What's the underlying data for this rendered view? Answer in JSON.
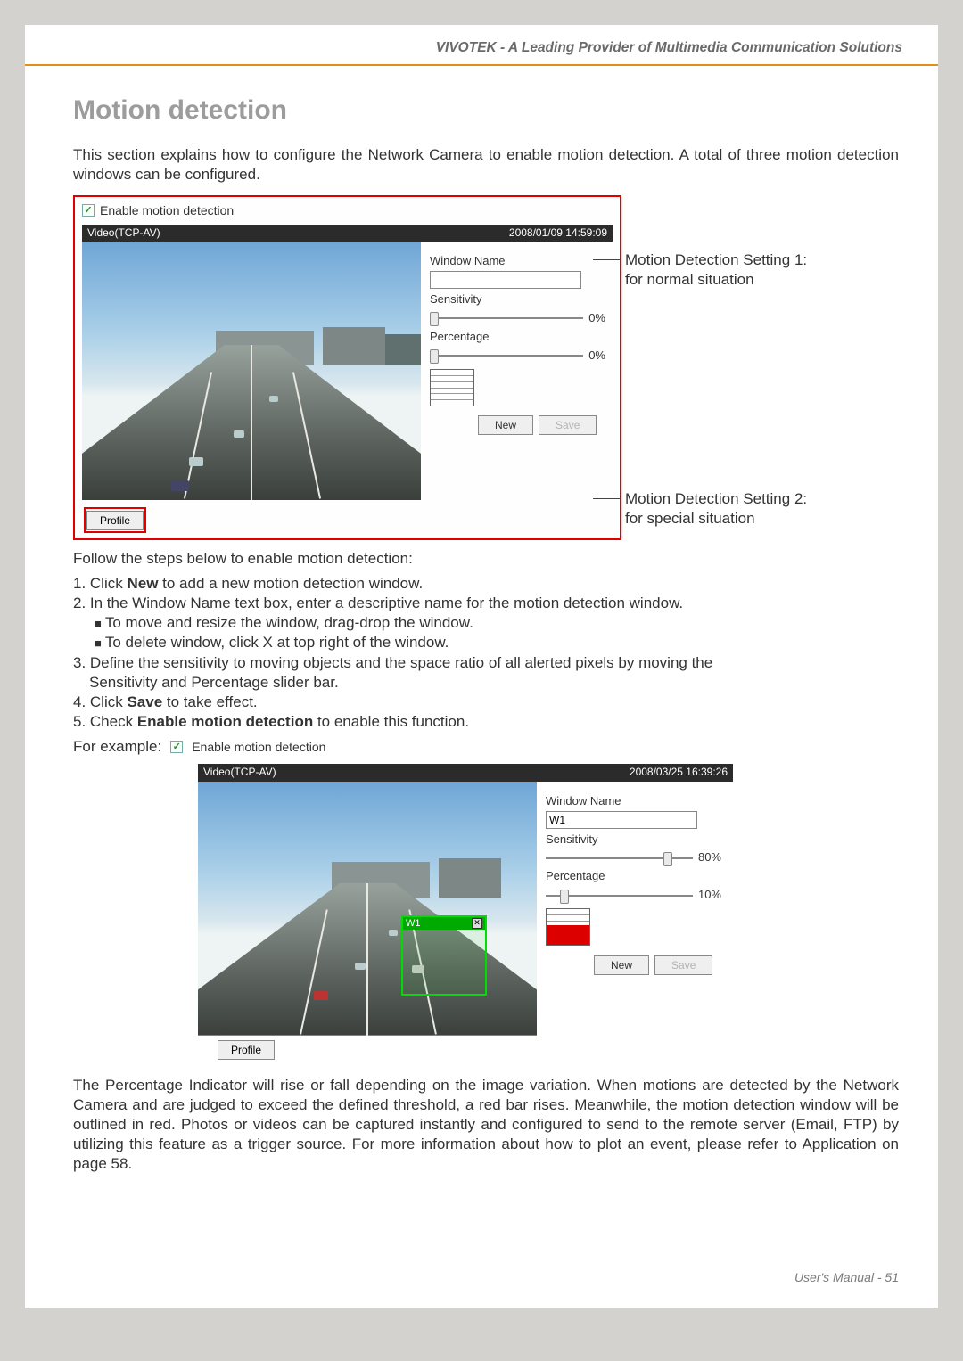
{
  "header": "VIVOTEK - A Leading Provider of Multimedia Communication Solutions",
  "title": "Motion detection",
  "intro": "This section explains how to configure the Network Camera to enable motion detection. A total of three motion detection windows can be configured.",
  "panel1": {
    "enable_label": "Enable motion detection",
    "video_label": "Video(TCP-AV)",
    "timestamp": "2008/01/09 14:59:09",
    "wnd_label": "Window Name",
    "wnd_value": "",
    "sens_label": "Sensitivity",
    "sens_value": "0%",
    "pct_label": "Percentage",
    "pct_value": "0%",
    "new_btn": "New",
    "save_btn": "Save",
    "profile_btn": "Profile"
  },
  "annotation1": "Motion Detection Setting 1: for normal situation",
  "annotation2": "Motion Detection Setting 2: for special situation",
  "steps_title": "Follow the steps below to enable motion detection:",
  "steps": {
    "s1_a": "1. Click ",
    "s1_b": "New",
    "s1_c": " to add a new motion detection window.",
    "s2": "2. In the Window Name text box, enter a descriptive name for the motion detection window.",
    "s2a": "To move and resize the window, drag-drop the window.",
    "s2b": "To delete window, click X at top right of the window.",
    "s3": "3. Define the sensitivity to moving objects and the space ratio of all alerted pixels by moving the Sensitivity and Percentage slider bar.",
    "s4_a": "4. Click ",
    "s4_b": "Save",
    "s4_c": " to take effect.",
    "s5_a": "5. Check ",
    "s5_b": "Enable motion detection",
    "s5_c": " to enable this function."
  },
  "forex_label": "For example:",
  "forex_chk": "Enable motion detection",
  "panel2": {
    "video_label": "Video(TCP-AV)",
    "timestamp": "2008/03/25 16:39:26",
    "md_window_name": "W1",
    "wnd_label": "Window Name",
    "wnd_value": "W1",
    "sens_label": "Sensitivity",
    "sens_value": "80%",
    "pct_label": "Percentage",
    "pct_value": "10%",
    "new_btn": "New",
    "save_btn": "Save",
    "profile_btn": "Profile"
  },
  "para2": "The Percentage Indicator will rise or fall depending on the image variation. When motions are detected by the Network Camera and are judged to exceed the defined threshold, a red bar rises. Meanwhile, the motion detection window will be outlined in red. Photos or videos can be captured instantly and configured to send to the remote server (Email, FTP) by utilizing this feature as a trigger source. For more information about how to plot an event, please refer to Application on page 58.",
  "footer": "User's Manual - 51"
}
